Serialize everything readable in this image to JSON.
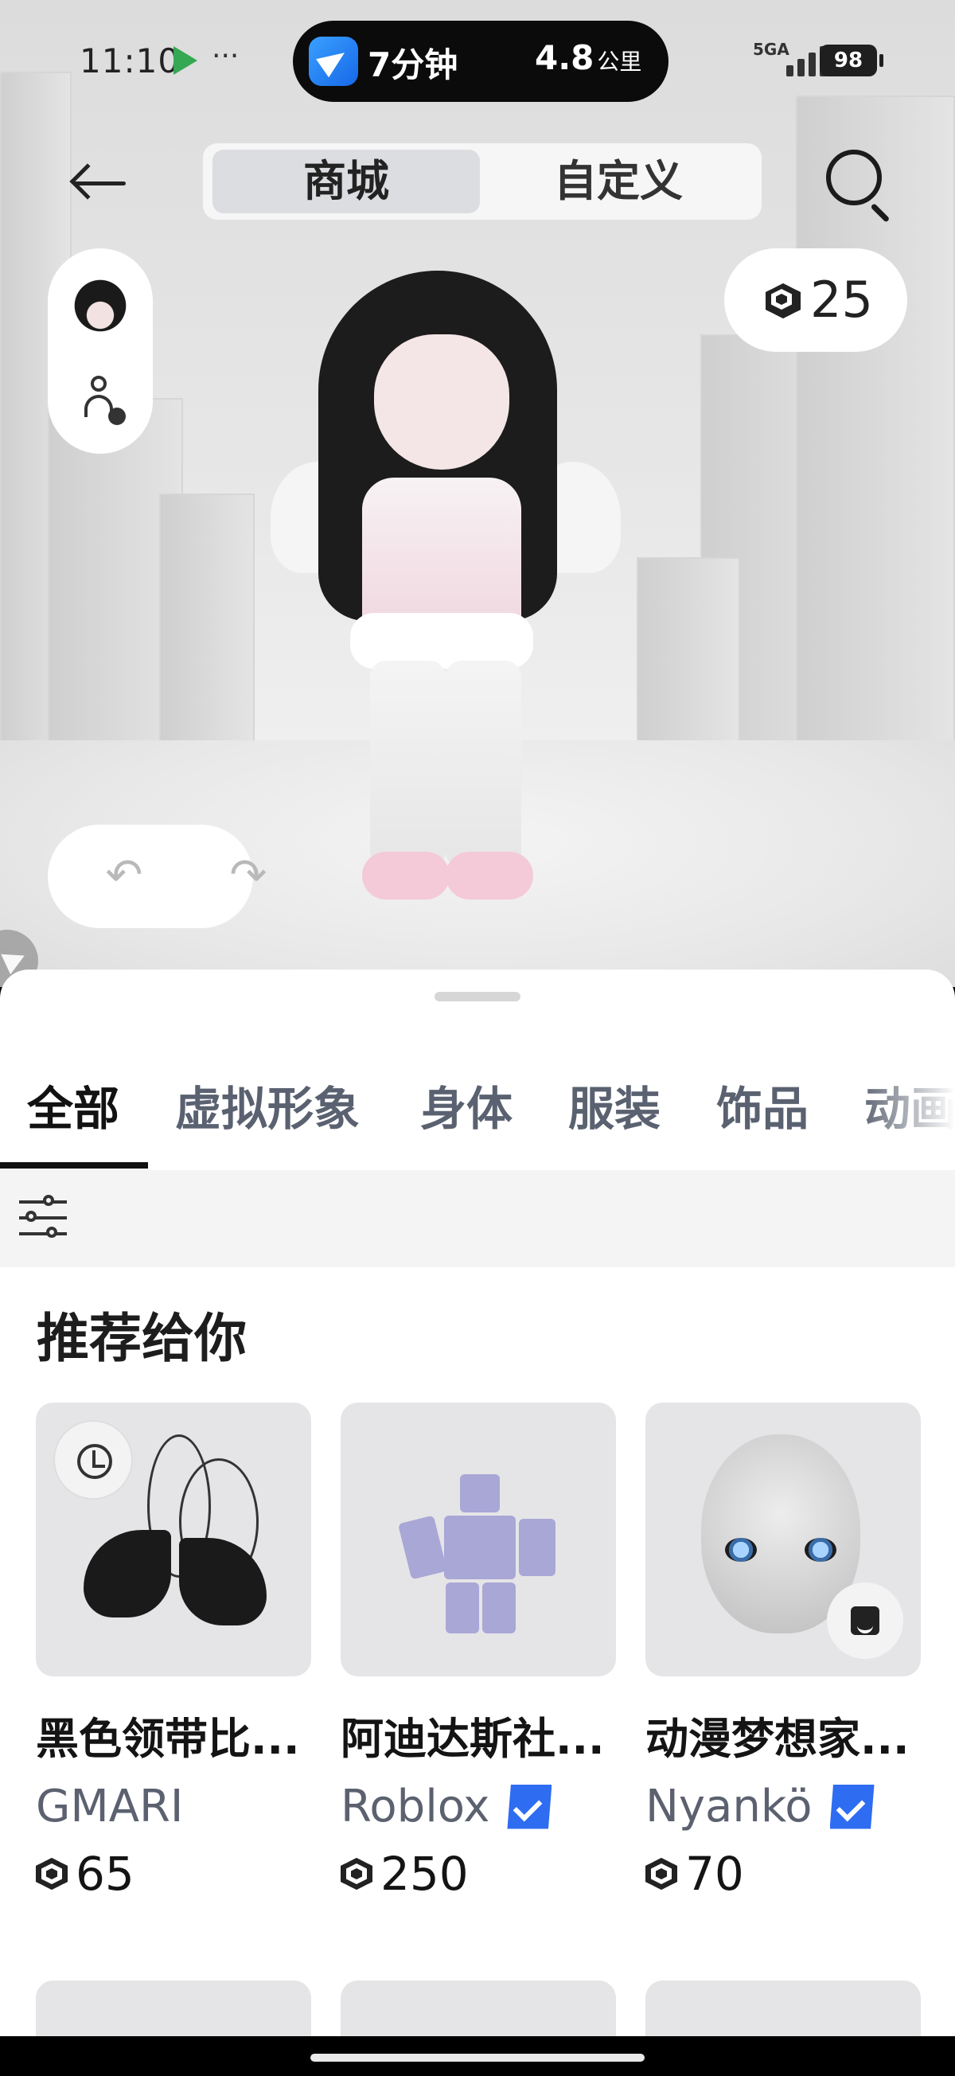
{
  "status_bar": {
    "time": "11:10",
    "more": "···",
    "nav_pill": {
      "minutes": "7分钟",
      "distance": "4.8",
      "distance_unit": "公里"
    },
    "network": "5GA",
    "battery": "98"
  },
  "header": {
    "segments": [
      {
        "label": "商城",
        "active": true
      },
      {
        "label": "自定义",
        "active": false
      }
    ]
  },
  "robux_balance": "25",
  "undo": {
    "undo_glyph": "↶",
    "redo_glyph": "↷"
  },
  "categories": [
    {
      "label": "全部",
      "active": true
    },
    {
      "label": "虚拟形象",
      "active": false
    },
    {
      "label": "身体",
      "active": false
    },
    {
      "label": "服装",
      "active": false
    },
    {
      "label": "饰品",
      "active": false
    },
    {
      "label": "动画",
      "active": false
    }
  ],
  "section_title": "推荐给你",
  "items": [
    {
      "name": "黑色领带比...",
      "creator": "GMARI",
      "verified": false,
      "price": "65",
      "badge_icon": "clock-icon"
    },
    {
      "name": "阿迪达斯社...",
      "creator": "Roblox",
      "verified": true,
      "price": "250",
      "badge_icon": ""
    },
    {
      "name": "动漫梦想家...",
      "creator": "Nyankö",
      "verified": true,
      "price": "70",
      "badge_icon": "emote-icon"
    }
  ],
  "colors": {
    "accent_blue": "#2e6cf2",
    "sheet_bg": "#ffffff",
    "scene_bg": "#e6e6e6"
  }
}
